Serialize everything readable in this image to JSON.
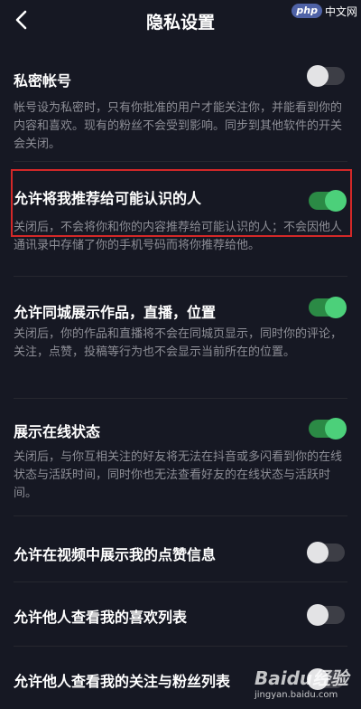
{
  "header": {
    "title": "隐私设置",
    "watermark_badge": "php",
    "watermark_text": "中文网"
  },
  "settings": [
    {
      "label": "私密帐号",
      "desc": "帐号设为私密时，只有你批准的用户才能关注你，并能看到你的内容和喜欢。现有的粉丝不会受到影响。同步到其他软件的开关会关闭。",
      "enabled": false
    },
    {
      "label": "允许将我推荐给可能认识的人",
      "desc": "关闭后，不会将你和你的内容推荐给可能认识的人；不会因他人通讯录中存储了你的手机号码而将你推荐给他。",
      "enabled": true
    },
    {
      "label": "允许同城展示作品，直播，位置",
      "desc": "关闭后，你的作品和直播将不会在同城页显示，同时你的评论，关注，点赞，投稿等行为也不会显示当前所在的位置。",
      "enabled": true
    },
    {
      "label": "展示在线状态",
      "desc": "关闭后，与你互相关注的好友将无法在抖音或多闪看到你的在线状态与活跃时间，同时你也无法查看好友的在线状态与活跃时间。",
      "enabled": true
    },
    {
      "label": "允许在视频中展示我的点赞信息",
      "desc": "",
      "enabled": false
    },
    {
      "label": "允许他人查看我的喜欢列表",
      "desc": "",
      "enabled": false
    },
    {
      "label": "允许他人查看我的关注与粉丝列表",
      "desc": "",
      "enabled": false
    }
  ],
  "baidu_watermark": {
    "main": "Baidu经验",
    "sub": "jingyan.baidu.com"
  },
  "colors": {
    "background": "#161823",
    "toggle_on": "#4cd07a",
    "toggle_off": "#3d3e46",
    "highlight": "#d32828"
  }
}
